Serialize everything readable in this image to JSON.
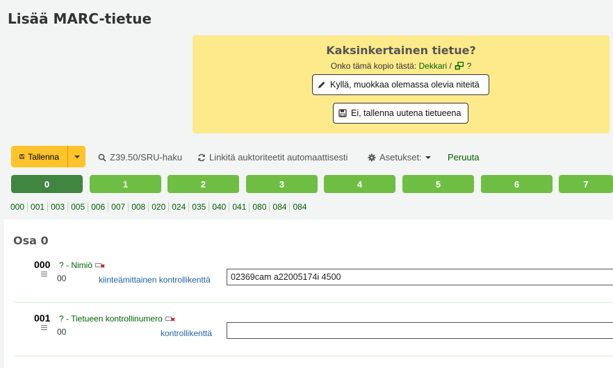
{
  "page": {
    "title": "Lisää MARC-tietue"
  },
  "duplicate": {
    "title": "Kaksinkertainen tietue?",
    "question_prefix": "Onko tämä kopio tästä:",
    "record_link": "Dekkari",
    "separator": "/",
    "question_suffix": "?",
    "edit_button": "Kyllä, muokkaa olemassa olevia niteitä",
    "save_new_button": "Ei, tallenna uutena tietueena"
  },
  "toolbar": {
    "save_label": "Tallenna",
    "z3950_label": "Z39.50/SRU-haku",
    "link_authorities_label": "Linkitä auktoriteetit automaattisesti",
    "settings_label": "Asetukset:",
    "cancel_label": "Peruuta"
  },
  "tabs": [
    "0",
    "1",
    "2",
    "3",
    "4",
    "5",
    "6",
    "7"
  ],
  "active_tab": "0",
  "tag_links": [
    "000",
    "001",
    "003",
    "005",
    "006",
    "007",
    "008",
    "020",
    "024",
    "035",
    "040",
    "041",
    "080",
    "084",
    "084"
  ],
  "section": {
    "title": "Osa 0"
  },
  "fields": [
    {
      "tag": "000",
      "description": "? - Nimiö",
      "indicators": "00",
      "subfield_label": "kiinteämittainen kontrollikenttä",
      "value": "02369cam a22005174i 4500"
    },
    {
      "tag": "001",
      "description": "? - Tietueen kontrollinumero",
      "indicators": "00",
      "subfield_label": "kontrollikenttä",
      "value": ""
    }
  ],
  "colors": {
    "warning_bg": "#fdea8a",
    "save_button": "#ffc32b",
    "tab_active": "#408540",
    "tab": "#6ebe44",
    "link_green": "#006100",
    "subfield_label": "#1f62a0"
  }
}
